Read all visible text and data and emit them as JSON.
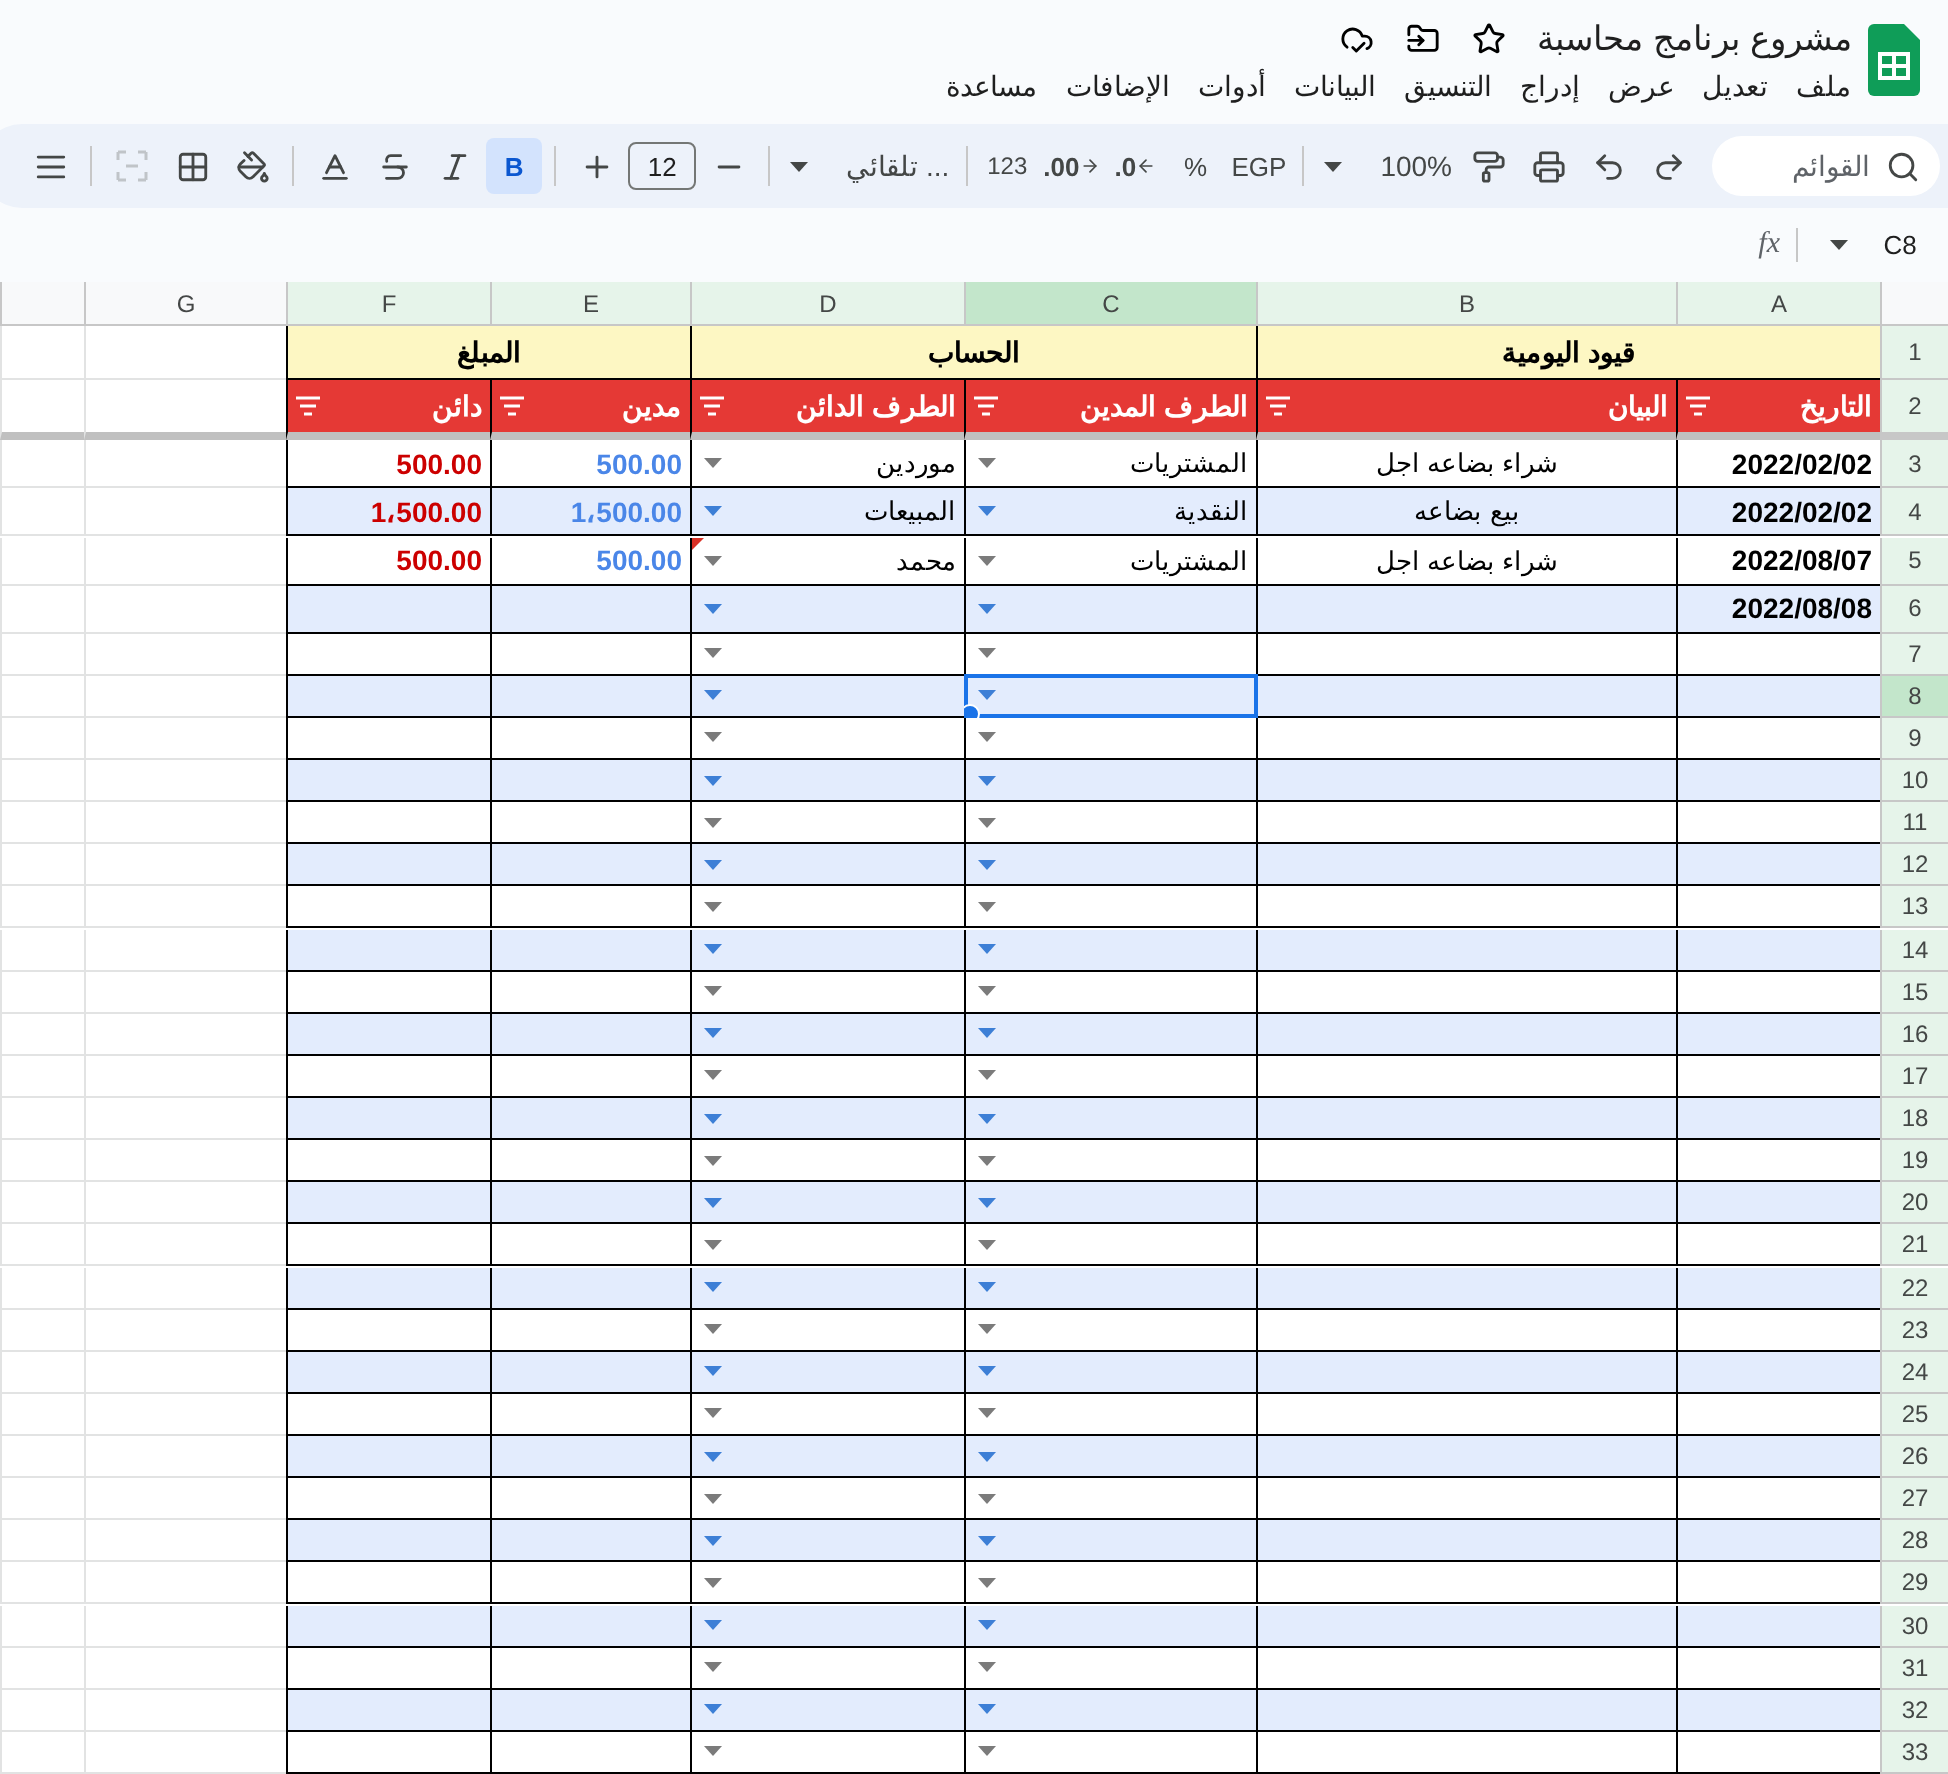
{
  "document": {
    "title": "مشروع برنامج محاسبة"
  },
  "menu": [
    "ملف",
    "تعديل",
    "عرض",
    "إدراج",
    "التنسيق",
    "البيانات",
    "أدوات",
    "الإضافات",
    "مساعدة"
  ],
  "toolbar": {
    "search_placeholder": "القوائم",
    "zoom": "100%",
    "currency": "EGP",
    "percent": "%",
    "decrease_decimals": ".0",
    "increase_decimals": ".00",
    "number_format": "123",
    "font": "تلقائي ...",
    "font_size": "12",
    "bold": {
      "label": "B",
      "selected": true
    },
    "merge": {
      "disabled": true
    }
  },
  "formula_bar": {
    "cell": "C8",
    "label": "fx"
  },
  "columns": [
    {
      "letter": "A",
      "selected": false,
      "tinted": true
    },
    {
      "letter": "B",
      "selected": false,
      "tinted": true
    },
    {
      "letter": "C",
      "selected": true,
      "tinted": true
    },
    {
      "letter": "D",
      "selected": false,
      "tinted": true
    },
    {
      "letter": "E",
      "selected": false,
      "tinted": true
    },
    {
      "letter": "F",
      "selected": false,
      "tinted": true
    },
    {
      "letter": "G",
      "selected": false,
      "tinted": false
    }
  ],
  "group_header": {
    "number": "1",
    "groups": [
      "قيود اليومية",
      "الحساب",
      "المبلغ"
    ]
  },
  "field_header": {
    "number": "2",
    "fields": [
      "التاريخ",
      "البيان",
      "الطرف المدين",
      "الطرف الدائن",
      "مدين",
      "دائن"
    ]
  },
  "rows": [
    {
      "number": "3",
      "shaded": false,
      "selected": false,
      "note": false,
      "date": "2022/02/02",
      "description": "شراء بضاعه اجل",
      "debit_account": "المشتريات",
      "credit_account": "موردين",
      "debit": "500.00",
      "credit": "500.00"
    },
    {
      "number": "4",
      "shaded": true,
      "selected": false,
      "note": false,
      "date": "2022/02/02",
      "description": "بيع بضاعه",
      "debit_account": "النقدية",
      "credit_account": "المبيعات",
      "debit": "1،500.00",
      "credit": "1،500.00"
    },
    {
      "number": "5",
      "shaded": false,
      "selected": false,
      "note": true,
      "date": "2022/08/07",
      "description": "شراء بضاعه اجل",
      "debit_account": "المشتريات",
      "credit_account": "محمد",
      "debit": "500.00",
      "credit": "500.00"
    },
    {
      "number": "6",
      "shaded": true,
      "selected": false,
      "note": false,
      "date": "2022/08/08"
    },
    {
      "number": "7",
      "shaded": false,
      "selected": false,
      "note": false
    },
    {
      "number": "8",
      "shaded": true,
      "selected": true,
      "note": false
    },
    {
      "number": "9",
      "shaded": false,
      "selected": false,
      "note": false
    },
    {
      "number": "10",
      "shaded": true,
      "selected": false,
      "note": false
    },
    {
      "number": "11",
      "shaded": false,
      "selected": false,
      "note": false
    },
    {
      "number": "12",
      "shaded": true,
      "selected": false,
      "note": false
    },
    {
      "number": "13",
      "shaded": false,
      "selected": false,
      "note": false
    },
    {
      "number": "14",
      "shaded": true,
      "selected": false,
      "note": false
    },
    {
      "number": "15",
      "shaded": false,
      "selected": false,
      "note": false
    },
    {
      "number": "16",
      "shaded": true,
      "selected": false,
      "note": false
    },
    {
      "number": "17",
      "shaded": false,
      "selected": false,
      "note": false
    },
    {
      "number": "18",
      "shaded": true,
      "selected": false,
      "note": false
    },
    {
      "number": "19",
      "shaded": false,
      "selected": false,
      "note": false
    },
    {
      "number": "20",
      "shaded": true,
      "selected": false,
      "note": false
    },
    {
      "number": "21",
      "shaded": false,
      "selected": false,
      "note": false
    },
    {
      "number": "22",
      "shaded": true,
      "selected": false,
      "note": false
    },
    {
      "number": "23",
      "shaded": false,
      "selected": false,
      "note": false
    },
    {
      "number": "24",
      "shaded": true,
      "selected": false,
      "note": false
    },
    {
      "number": "25",
      "shaded": false,
      "selected": false,
      "note": false
    },
    {
      "number": "26",
      "shaded": true,
      "selected": false,
      "note": false
    },
    {
      "number": "27",
      "shaded": false,
      "selected": false,
      "note": false
    },
    {
      "number": "28",
      "shaded": true,
      "selected": false,
      "note": false
    },
    {
      "number": "29",
      "shaded": false,
      "selected": false,
      "note": false
    },
    {
      "number": "30",
      "shaded": true,
      "selected": false,
      "note": false
    },
    {
      "number": "31",
      "shaded": false,
      "selected": false,
      "note": false
    },
    {
      "number": "32",
      "shaded": true,
      "selected": false,
      "note": false
    },
    {
      "number": "33",
      "shaded": false,
      "selected": false,
      "note": false
    }
  ]
}
